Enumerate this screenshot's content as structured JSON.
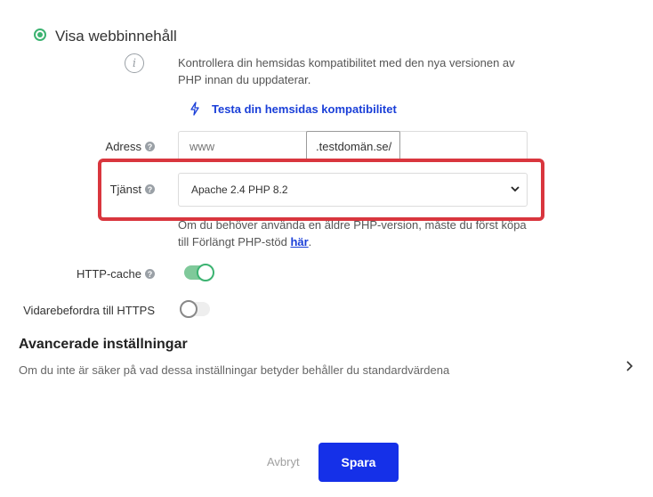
{
  "web_content": {
    "radio_label": "Visa webbinnehåll",
    "info_text": "Kontrollera din hemsidas kompatibilitet med den nya versionen av PHP innan du uppdaterar.",
    "test_link": "Testa din hemsidas kompatibilitet"
  },
  "address": {
    "label": "Adress",
    "placeholder": "www",
    "domain": ".testdomän.se/"
  },
  "service": {
    "label": "Tjänst",
    "selected": "Apache 2.4 PHP 8.2",
    "note_prefix": "Om du behöver använda en äldre PHP-version, måste du först köpa till Förlängt PHP-stöd ",
    "note_link": "här",
    "note_suffix": "."
  },
  "http_cache": {
    "label": "HTTP-cache",
    "enabled": true
  },
  "https_redirect": {
    "label": "Vidarebefordra till HTTPS",
    "enabled": false
  },
  "advanced": {
    "title": "Avancerade inställningar",
    "description": "Om du inte är säker på vad dessa inställningar betyder behåller du standardvärdena"
  },
  "actions": {
    "cancel": "Avbryt",
    "save": "Spara"
  },
  "colors": {
    "accent_green": "#3cb371",
    "link_blue": "#1a3fd8",
    "primary_button": "#1530e8",
    "highlight_red": "#d9363e"
  },
  "icons": {
    "help": "?",
    "info": "i"
  }
}
